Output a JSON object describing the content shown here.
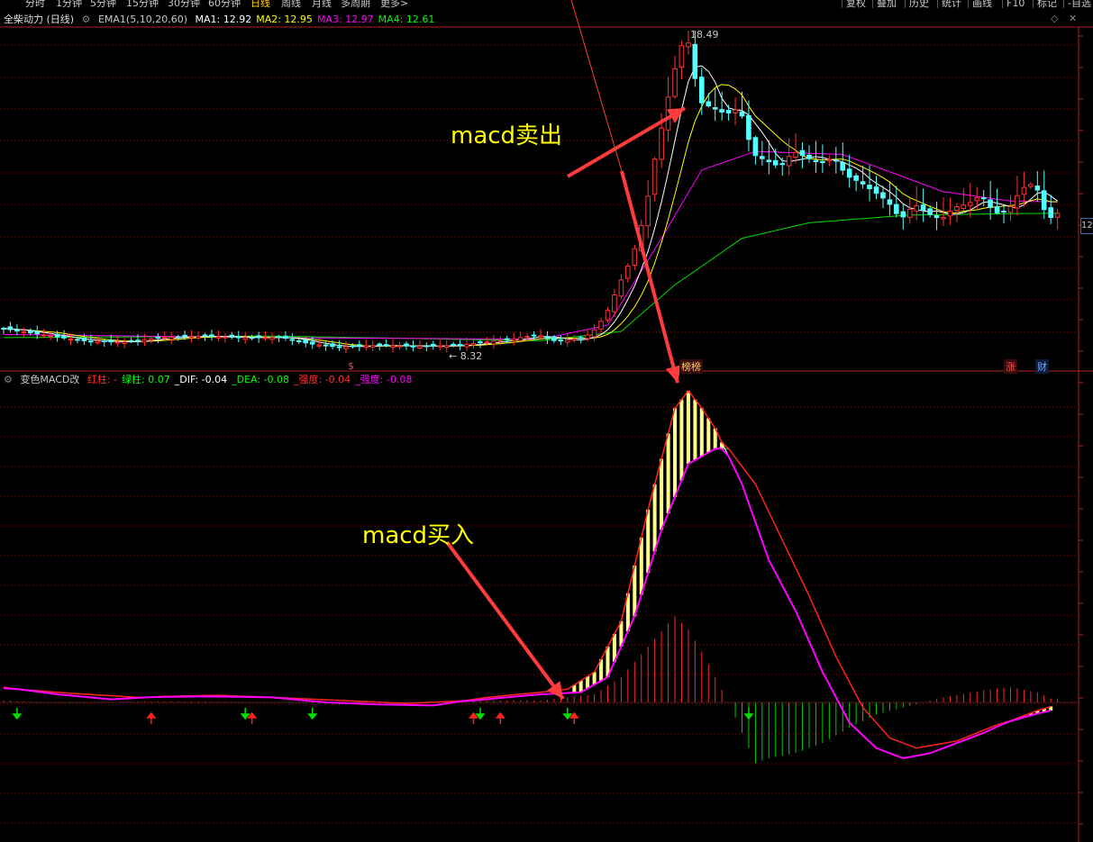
{
  "toolbar": {
    "periods": [
      "分时",
      "1分钟",
      "5分钟",
      "15分钟",
      "30分钟",
      "60分钟",
      "日线",
      "周线",
      "月线",
      "多周期",
      "更多>"
    ],
    "active_period": "日线",
    "right_buttons": [
      "复权",
      "叠加",
      "历史",
      "统计",
      "画线",
      "F10",
      "标记",
      "-自选"
    ]
  },
  "main_panel": {
    "title": "全柴动力 (日线)",
    "indicator": "EMA1(5,10,20,60)",
    "ma_values": [
      {
        "label": "MA1: 12.92",
        "color": "#ffffff"
      },
      {
        "label": "MA2: 12.95",
        "color": "#ffff00"
      },
      {
        "label": "MA3: 12.97",
        "color": "#ff00ff"
      },
      {
        "label": "MA4: 12.61",
        "color": "#00ff00"
      }
    ],
    "high_label": "18.49",
    "low_label": "8.32",
    "last_price_tag": "12",
    "event_badges": {
      "limit_list": "榜榜",
      "rise": "涨",
      "fin": "财",
      "s_marker": "$"
    }
  },
  "macd_panel": {
    "title": "变色MACD改",
    "items": [
      {
        "label": "红柱: -",
        "color": "#ff3030"
      },
      {
        "label": "绿柱: 0.07",
        "color": "#00ff00"
      },
      {
        "label": "_DIF: -0.04",
        "color": "#ffffff"
      },
      {
        "label": "_DEA: -0.08",
        "color": "#00ff00"
      },
      {
        "label": "_强度: -0.04",
        "color": "#ff3030"
      },
      {
        "label": "_强度: -0.08",
        "color": "#ff00ff"
      }
    ]
  },
  "annotations": {
    "sell_text": "macd卖出",
    "buy_text": "macd买入"
  },
  "colors": {
    "up": "#ff3232",
    "down": "#54ffff",
    "dif": "#ffffff",
    "dea": "#00ff00",
    "strength_red": "#ff2020",
    "strength_mag": "#ff00ff",
    "arrow": "#ff3c3c",
    "grid": "#7a1010"
  },
  "chart_data": {
    "type": "candlestick",
    "title": "全柴动力 (日线)",
    "price_extremes": {
      "high": 18.49,
      "low": 8.32
    },
    "x_range": [
      0,
      160
    ],
    "price_keypoints": [
      [
        0,
        8.9
      ],
      [
        6,
        8.7
      ],
      [
        12,
        8.5
      ],
      [
        18,
        8.45
      ],
      [
        24,
        8.6
      ],
      [
        30,
        8.65
      ],
      [
        36,
        8.6
      ],
      [
        42,
        8.6
      ],
      [
        46,
        8.4
      ],
      [
        50,
        8.3
      ],
      [
        56,
        8.35
      ],
      [
        62,
        8.32
      ],
      [
        68,
        8.35
      ],
      [
        72,
        8.45
      ],
      [
        76,
        8.55
      ],
      [
        80,
        8.7
      ],
      [
        82,
        8.5
      ],
      [
        86,
        8.55
      ],
      [
        88,
        8.75
      ],
      [
        90,
        9.3
      ],
      [
        92,
        10.3
      ],
      [
        94,
        11.2
      ],
      [
        96,
        12.7
      ],
      [
        97,
        14.0
      ],
      [
        98,
        15.0
      ],
      [
        100,
        17.0
      ],
      [
        102,
        18.49
      ],
      [
        104,
        16.2
      ],
      [
        106,
        16.0
      ],
      [
        108,
        15.8
      ],
      [
        110,
        16.0
      ],
      [
        112,
        14.5
      ],
      [
        114,
        14.3
      ],
      [
        116,
        14.1
      ],
      [
        118,
        14.6
      ],
      [
        120,
        14.4
      ],
      [
        122,
        14.2
      ],
      [
        124,
        14.4
      ],
      [
        126,
        13.8
      ],
      [
        128,
        13.6
      ],
      [
        132,
        13.0
      ],
      [
        134,
        12.4
      ],
      [
        136,
        12.9
      ],
      [
        138,
        12.6
      ],
      [
        140,
        12.4
      ],
      [
        142,
        12.8
      ],
      [
        144,
        12.9
      ],
      [
        146,
        13.2
      ],
      [
        148,
        12.6
      ],
      [
        150,
        12.7
      ],
      [
        152,
        13.4
      ],
      [
        154,
        13.6
      ],
      [
        155,
        12.9
      ],
      [
        156,
        12.4
      ],
      [
        157,
        12.6
      ]
    ],
    "ma_series": [
      {
        "name": "MA4",
        "points": [
          [
            0,
            8.6
          ],
          [
            40,
            8.65
          ],
          [
            80,
            8.5
          ],
          [
            92,
            8.8
          ],
          [
            100,
            10.3
          ],
          [
            110,
            11.8
          ],
          [
            120,
            12.3
          ],
          [
            135,
            12.55
          ],
          [
            157,
            12.61
          ]
        ]
      },
      {
        "name": "MA3",
        "points": [
          [
            0,
            8.7
          ],
          [
            40,
            8.6
          ],
          [
            80,
            8.55
          ],
          [
            90,
            9.0
          ],
          [
            98,
            11.8
          ],
          [
            104,
            14.0
          ],
          [
            112,
            14.6
          ],
          [
            125,
            14.5
          ],
          [
            140,
            13.3
          ],
          [
            150,
            13.0
          ],
          [
            157,
            12.97
          ]
        ]
      }
    ],
    "macd": {
      "dif": [
        [
          0,
          0.15
        ],
        [
          8,
          0.08
        ],
        [
          16,
          0.03
        ],
        [
          24,
          0.06
        ],
        [
          32,
          0.07
        ],
        [
          40,
          0.05
        ],
        [
          48,
          0.0
        ],
        [
          56,
          -0.02
        ],
        [
          64,
          -0.03
        ],
        [
          72,
          0.05
        ],
        [
          80,
          0.1
        ],
        [
          84,
          0.13
        ],
        [
          88,
          0.3
        ],
        [
          92,
          0.8
        ],
        [
          96,
          1.9
        ],
        [
          100,
          2.9
        ],
        [
          102,
          3.07
        ],
        [
          104,
          2.9
        ],
        [
          106,
          2.7
        ],
        [
          110,
          2.15
        ],
        [
          114,
          1.4
        ],
        [
          118,
          0.9
        ],
        [
          122,
          0.3
        ],
        [
          126,
          -0.2
        ],
        [
          130,
          -0.45
        ],
        [
          134,
          -0.55
        ],
        [
          138,
          -0.5
        ],
        [
          142,
          -0.4
        ],
        [
          146,
          -0.3
        ],
        [
          150,
          -0.18
        ],
        [
          154,
          -0.08
        ],
        [
          156,
          -0.04
        ]
      ],
      "dea": [
        [
          0,
          0.14
        ],
        [
          10,
          0.09
        ],
        [
          20,
          0.05
        ],
        [
          30,
          0.06
        ],
        [
          40,
          0.05
        ],
        [
          50,
          0.02
        ],
        [
          60,
          -0.01
        ],
        [
          70,
          0.02
        ],
        [
          80,
          0.08
        ],
        [
          86,
          0.1
        ],
        [
          90,
          0.25
        ],
        [
          94,
          0.85
        ],
        [
          98,
          1.7
        ],
        [
          102,
          2.35
        ],
        [
          106,
          2.5
        ],
        [
          108,
          2.5
        ],
        [
          112,
          2.15
        ],
        [
          116,
          1.6
        ],
        [
          120,
          1.05
        ],
        [
          124,
          0.45
        ],
        [
          128,
          -0.05
        ],
        [
          132,
          -0.35
        ],
        [
          136,
          -0.45
        ],
        [
          142,
          -0.38
        ],
        [
          148,
          -0.22
        ],
        [
          154,
          -0.11
        ],
        [
          156,
          -0.08
        ]
      ],
      "histogram": [
        [
          0,
          0.02
        ],
        [
          10,
          -0.01
        ],
        [
          20,
          0.01
        ],
        [
          30,
          0.01
        ],
        [
          40,
          0.0
        ],
        [
          50,
          -0.02
        ],
        [
          60,
          -0.02
        ],
        [
          70,
          0.02
        ],
        [
          80,
          0.02
        ],
        [
          88,
          0.08
        ],
        [
          92,
          0.25
        ],
        [
          96,
          0.55
        ],
        [
          100,
          0.85
        ],
        [
          102,
          0.72
        ],
        [
          104,
          0.5
        ],
        [
          106,
          0.25
        ],
        [
          108,
          0.0
        ],
        [
          110,
          -0.3
        ],
        [
          112,
          -0.6
        ],
        [
          114,
          -0.55
        ],
        [
          118,
          -0.5
        ],
        [
          122,
          -0.4
        ],
        [
          126,
          -0.25
        ],
        [
          130,
          -0.12
        ],
        [
          134,
          -0.05
        ],
        [
          140,
          0.05
        ],
        [
          146,
          0.12
        ],
        [
          150,
          0.15
        ],
        [
          154,
          0.1
        ],
        [
          156,
          0.04
        ]
      ]
    },
    "signals": {
      "buy_x": 85,
      "sell_x": 102
    }
  }
}
